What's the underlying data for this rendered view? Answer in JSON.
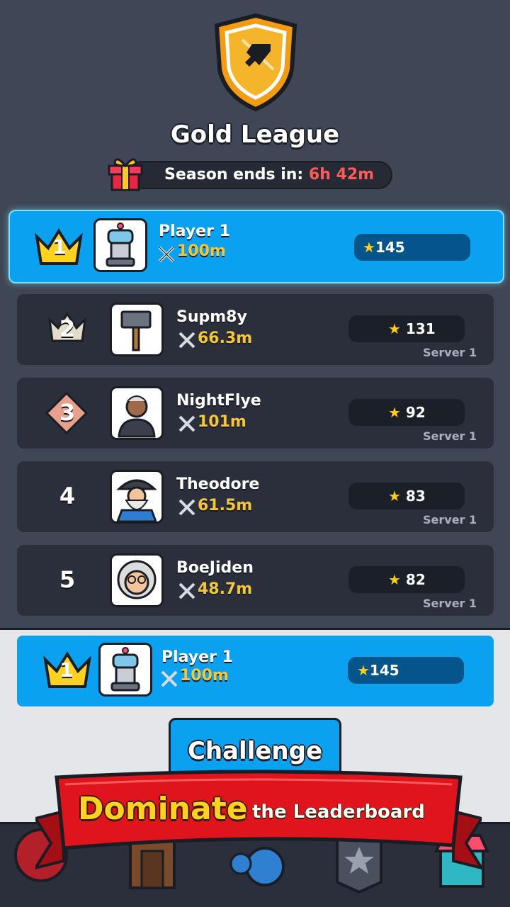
{
  "header": {
    "league_title": "Gold League",
    "season_label": "Season ends in:",
    "season_time": "6h 42m"
  },
  "leaderboard": [
    {
      "rank": "1",
      "name": "Player 1",
      "power": "100m",
      "score": "145",
      "server": "",
      "highlight": true
    },
    {
      "rank": "2",
      "name": "Supm8y",
      "power": "66.3m",
      "score": "131",
      "server": "Server 1"
    },
    {
      "rank": "3",
      "name": "NightFlye",
      "power": "101m",
      "score": "92",
      "server": "Server 1"
    },
    {
      "rank": "4",
      "name": "Theodore",
      "power": "61.5m",
      "score": "83",
      "server": "Server 1"
    },
    {
      "rank": "5",
      "name": "BoeJiden",
      "power": "48.7m",
      "score": "82",
      "server": "Server 1"
    }
  ],
  "current_player": {
    "rank": "1",
    "name": "Player 1",
    "power": "100m",
    "score": "145"
  },
  "challenge_button": "Challenge",
  "banner": {
    "big": "Dominate",
    "small": "the Leaderboard"
  },
  "icons": {
    "star": "★",
    "crown": "crown-icon",
    "sword": "crossed-swords-icon",
    "gift": "gift-icon"
  },
  "colors": {
    "accent": "#0aa2f0",
    "gold": "#f5c53a",
    "timer": "#ff5a5a",
    "banner": "#e0141c"
  }
}
